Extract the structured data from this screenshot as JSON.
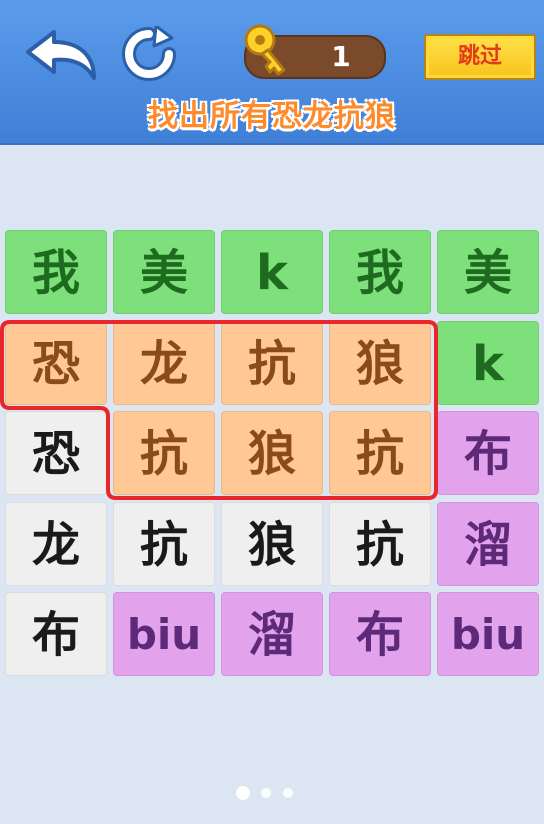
{
  "header": {
    "back_icon": "back-arrow-icon",
    "refresh_icon": "refresh-icon",
    "key_icon": "key-icon",
    "key_count": "1",
    "skip_label": "跳过"
  },
  "title": "找出所有恐龙抗狼",
  "board": {
    "rows": [
      [
        {
          "text": "我",
          "color": "green"
        },
        {
          "text": "美",
          "color": "green"
        },
        {
          "text": "k",
          "color": "green"
        },
        {
          "text": "我",
          "color": "green"
        },
        {
          "text": "美",
          "color": "green"
        }
      ],
      [
        {
          "text": "恐",
          "color": "orange"
        },
        {
          "text": "龙",
          "color": "orange"
        },
        {
          "text": "抗",
          "color": "orange"
        },
        {
          "text": "狼",
          "color": "orange"
        },
        {
          "text": "k",
          "color": "green"
        }
      ],
      [
        {
          "text": "恐",
          "color": "white"
        },
        {
          "text": "抗",
          "color": "orange"
        },
        {
          "text": "狼",
          "color": "orange"
        },
        {
          "text": "抗",
          "color": "orange"
        },
        {
          "text": "布",
          "color": "purple"
        }
      ],
      [
        {
          "text": "龙",
          "color": "white"
        },
        {
          "text": "抗",
          "color": "white"
        },
        {
          "text": "狼",
          "color": "white"
        },
        {
          "text": "抗",
          "color": "white"
        },
        {
          "text": "溜",
          "color": "purple"
        }
      ],
      [
        {
          "text": "布",
          "color": "white"
        },
        {
          "text": "biu",
          "color": "purple"
        },
        {
          "text": "溜",
          "color": "purple"
        },
        {
          "text": "布",
          "color": "purple"
        },
        {
          "text": "biu",
          "color": "purple"
        }
      ]
    ],
    "selection_outline_color": "#e8262c"
  },
  "pager": {
    "count": 3,
    "active": 0
  },
  "colors": {
    "header_bg": "#4a8ae0",
    "page_bg": "#dce6f3",
    "skip_bg": "#f7c21c",
    "title_text": "#ff8a2a"
  }
}
